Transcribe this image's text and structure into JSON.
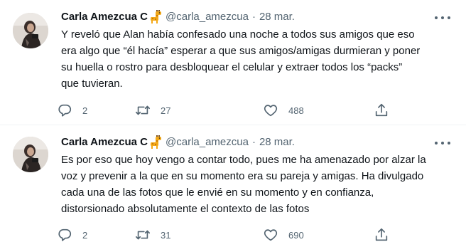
{
  "tweets": [
    {
      "author": {
        "display_name": "Carla Amezcua C",
        "emoji": "giraffe-emoji",
        "handle": "@carla_amezcua",
        "date": "28 mar."
      },
      "text_lines": [
        "Y reveló que Alan había confesado una noche a todos sus amigos que eso",
        "era algo que “él hacía” esperar a que sus amigos/amigas durmieran y poner",
        "su huella o rostro para desbloquear el celular y extraer todos los “packs”",
        "que tuvieran."
      ],
      "stats": {
        "replies": "2",
        "retweets": "27",
        "likes": "488"
      }
    },
    {
      "author": {
        "display_name": "Carla Amezcua C",
        "emoji": "giraffe-emoji",
        "handle": "@carla_amezcua",
        "date": "28 mar."
      },
      "text_lines": [
        "Es por eso que hoy vengo a contar todo, pues me ha amenazado por alzar la",
        "voz y prevenir a la que en su momento era su pareja y amigas. Ha divulgado",
        "cada una de las fotos que le envié en su momento y en confianza,",
        "distorsionado absolutamente el contexto de las fotos"
      ],
      "stats": {
        "replies": "2",
        "retweets": "31",
        "likes": "690"
      }
    }
  ],
  "separator": "·",
  "icons": {
    "reply": "reply-icon",
    "retweet": "retweet-icon",
    "like": "heart-icon",
    "share": "share-icon",
    "more": "more-icon"
  },
  "colors": {
    "text": "#0f1419",
    "secondary": "#536471",
    "divider": "#eff3f4",
    "giraffe": "#f4a917"
  }
}
